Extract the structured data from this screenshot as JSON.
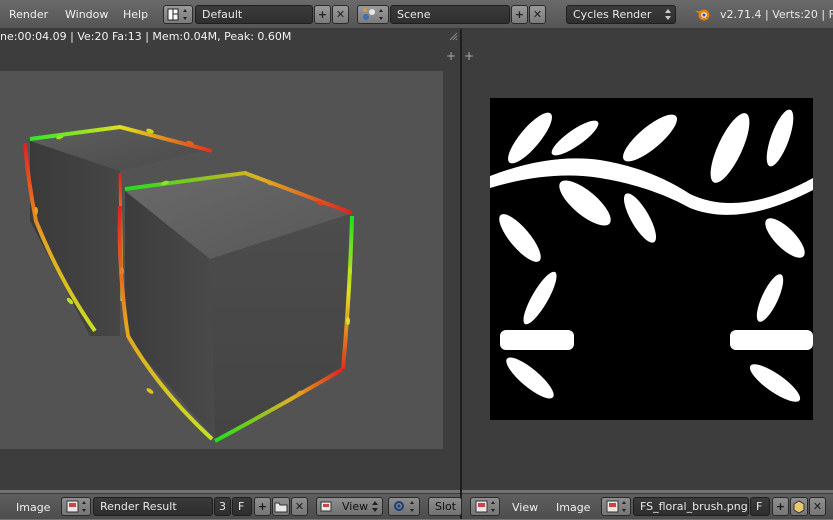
{
  "menu": {
    "render": "Render",
    "window": "Window",
    "help": "Help"
  },
  "layout": {
    "value": "Default"
  },
  "scene": {
    "value": "Scene"
  },
  "engine": {
    "value": "Cycles Render"
  },
  "status": {
    "text": "v2.71.4 | Verts:20 | Fa"
  },
  "render_info": {
    "text": "ne:00:04.09 | Ve:20 Fa:13 | Mem:0.04M, Peak: 0.60M"
  },
  "left_bar": {
    "image_menu": "Image",
    "image_name": "Render Result",
    "users": "3",
    "fake_user": "F",
    "view_label": "View",
    "slot_label": "Slot"
  },
  "right_bar": {
    "view_menu": "View",
    "image_menu": "Image",
    "image_name": "FS_floral_brush.png",
    "fake_user": "F"
  },
  "colors": {
    "header": "#555555",
    "panel": "#3d3d3d",
    "render_bg": "#535353"
  }
}
